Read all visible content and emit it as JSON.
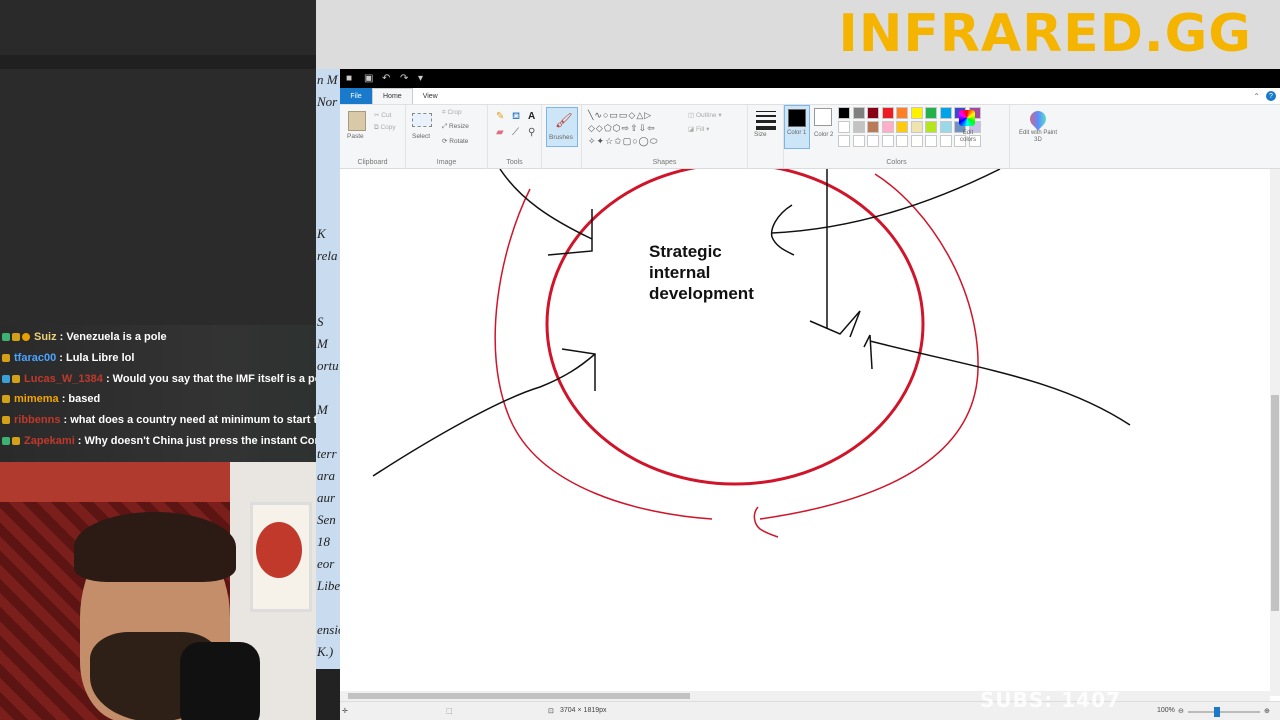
{
  "banner": {
    "title": "INFRARED.GG"
  },
  "subs": {
    "text": "SUBS: 1407"
  },
  "chat": [
    {
      "user": "Suiz",
      "user_color": "#e8d17a",
      "badges": [
        "b-green",
        "b-gold",
        "b-orange"
      ],
      "message": "Venezuela is a pole"
    },
    {
      "user": "tfarac00",
      "user_color": "#4aa3ff",
      "badges": [
        "b-gold"
      ],
      "message": "Lula Libre lol"
    },
    {
      "user": "Lucas_W_1384",
      "user_color": "#c0392b",
      "badges": [
        "b-blue",
        "b-gold"
      ],
      "message": "Would you say that the IMF itself is a pol"
    },
    {
      "user": "mimema",
      "user_color": "#f0a500",
      "badges": [
        "b-gold"
      ],
      "message": "based"
    },
    {
      "user": "ribbenns",
      "user_color": "#c0392b",
      "badges": [
        "b-gold"
      ],
      "message": "what does a country need at minimum to start thi"
    },
    {
      "user": "Zapekami",
      "user_color": "#c0392b",
      "badges": [
        "b-green",
        "b-gold"
      ],
      "message": "Why doesn't China just press the instant Com"
    }
  ],
  "map_labels": [
    "n M",
    "Nor",
    "",
    "",
    "",
    "",
    "",
    "K",
    "rela",
    "",
    "",
    "S",
    "M",
    "ortu",
    "",
    "M",
    "",
    "terr",
    "ara",
    "aur",
    "Sen",
    "18",
    "eor",
    "Libe",
    "",
    "ensio",
    "K.)"
  ],
  "paint": {
    "menu": {
      "file": "File",
      "home": "Home",
      "view": "View"
    },
    "ribbon": {
      "clipboard": {
        "label": "Clipboard",
        "paste": "Paste",
        "cut": "Cut",
        "copy": "Copy"
      },
      "image": {
        "label": "Image",
        "select": "Select",
        "crop": "Crop",
        "resize": "Resize",
        "rotate": "Rotate"
      },
      "tools": {
        "label": "Tools"
      },
      "brushes": {
        "label": "Brushes"
      },
      "shapes": {
        "label": "Shapes",
        "outline": "Outline",
        "fill": "Fill"
      },
      "size": {
        "label": "Size"
      },
      "colors": {
        "label": "Colors",
        "color1": "Color 1",
        "color2": "Color 2",
        "edit_colors": "Edit colors",
        "edit_with_paint3d": "Edit with Paint 3D",
        "color1_value": "#000000",
        "color2_value": "#ffffff",
        "palette_row1": [
          "#000000",
          "#7f7f7f",
          "#880015",
          "#ed1c24",
          "#ff7f27",
          "#fff200",
          "#22b14c",
          "#00a2e8",
          "#3f48cc",
          "#a349a4"
        ],
        "palette_row2": [
          "#ffffff",
          "#c3c3c3",
          "#b97a57",
          "#ffaec9",
          "#ffc90e",
          "#efe4b0",
          "#b5e61d",
          "#99d9ea",
          "#7092be",
          "#c8bfe7"
        ],
        "palette_row3": [
          "#ffffff",
          "#ffffff",
          "#ffffff",
          "#ffffff",
          "#ffffff",
          "#ffffff",
          "#ffffff",
          "#ffffff",
          "#ffffff",
          "#ffffff"
        ]
      }
    },
    "canvas_text": "Strategic\ninternal\ndevelopment",
    "status": {
      "dimensions": "3704 × 1819px",
      "zoom": "100%"
    }
  }
}
